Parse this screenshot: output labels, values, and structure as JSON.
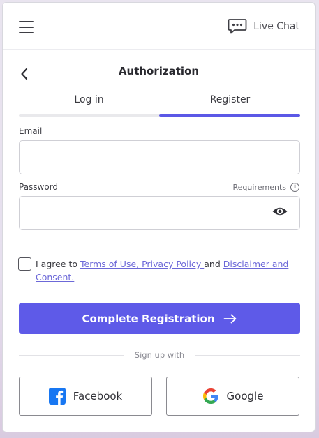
{
  "header": {
    "live_chat_label": "Live Chat"
  },
  "page": {
    "title": "Authorization"
  },
  "tabs": [
    {
      "label": "Log in",
      "active": false
    },
    {
      "label": "Register",
      "active": true
    }
  ],
  "form": {
    "email_label": "Email",
    "email_value": "",
    "password_label": "Password",
    "password_value": "",
    "requirements_label": "Requirements"
  },
  "agreement": {
    "prefix": "I agree to ",
    "terms_link": "Terms of Use, Privacy Policy ",
    "middle": "and ",
    "disclaimer_link": "Disclaimer and Consent.",
    "checked": false
  },
  "cta": {
    "label": "Complete Registration"
  },
  "social": {
    "divider_label": "Sign up with",
    "facebook_label": "Facebook",
    "google_label": "Google"
  },
  "colors": {
    "accent": "#5e5ae8",
    "link": "#6c68d8",
    "facebook": "#1877f2"
  },
  "icons": [
    "menu-icon",
    "chat-icon",
    "back-arrow-icon",
    "info-icon",
    "eye-icon",
    "arrow-right-icon",
    "facebook-icon",
    "google-icon"
  ]
}
